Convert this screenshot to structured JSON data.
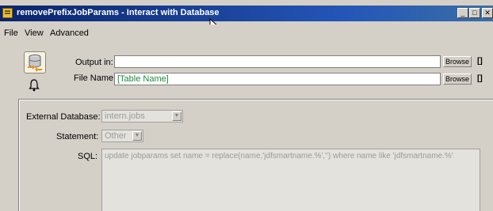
{
  "window": {
    "title": "removePrefixJobParams - Interact with Database",
    "min_glyph": "_",
    "max_glyph": "□",
    "close_glyph": "✕"
  },
  "menu": {
    "items": [
      "File",
      "View",
      "Advanced"
    ]
  },
  "output": {
    "output_in_label": "Output in:",
    "output_in_value": "",
    "file_name_label": "File Name:",
    "file_name_value": "[Table Name]",
    "browse_label": "Browse",
    "bracket_label": "[]"
  },
  "database": {
    "external_db_label": "External Database:",
    "external_db_value": "intern.jobs",
    "statement_label": "Statement:",
    "statement_value": "Other",
    "sql_label": "SQL:",
    "sql_value": "update jobparams set name = replace(name,'jdfsmartname.%','') where name like 'jdfsmartname.%'"
  },
  "icons": {
    "app": "grid-icon",
    "database": "database-icon",
    "notification": "bell-icon",
    "cursor": "mouse-cursor-icon"
  },
  "colors": {
    "title_bar": "#0a246a",
    "window_bg": "#d4d0c8",
    "file_name_text": "#1e8c3a"
  }
}
